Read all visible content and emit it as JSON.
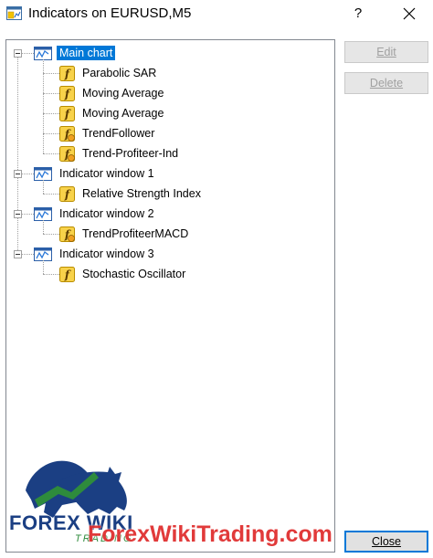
{
  "window": {
    "title": "Indicators on EURUSD,M5",
    "help_label": "?"
  },
  "tree": {
    "groups": [
      {
        "label": "Main chart",
        "selected": true,
        "items": [
          {
            "label": "Parabolic SAR",
            "icon": "builtin-indicator-icon"
          },
          {
            "label": "Moving Average",
            "icon": "builtin-indicator-icon"
          },
          {
            "label": "Moving Average",
            "icon": "builtin-indicator-icon"
          },
          {
            "label": "TrendFollower",
            "icon": "custom-indicator-icon"
          },
          {
            "label": "Trend-Profiteer-Ind",
            "icon": "custom-indicator-icon"
          }
        ]
      },
      {
        "label": "Indicator window 1",
        "selected": false,
        "items": [
          {
            "label": "Relative Strength Index",
            "icon": "builtin-indicator-icon"
          }
        ]
      },
      {
        "label": "Indicator window 2",
        "selected": false,
        "items": [
          {
            "label": "TrendProfiteerMACD",
            "icon": "custom-indicator-icon"
          }
        ]
      },
      {
        "label": "Indicator window 3",
        "selected": false,
        "items": [
          {
            "label": "Stochastic Oscillator",
            "icon": "builtin-indicator-icon"
          }
        ]
      }
    ]
  },
  "buttons": {
    "edit": "Edit",
    "delete": "Delete",
    "close": "Close"
  },
  "watermark": {
    "logo_main": "FOREX WIKI",
    "logo_sub": "TRADING",
    "site": "ForexWikiTrading.com"
  },
  "colors": {
    "selection": "#0078d7",
    "watermark": "#e03030",
    "logo_blue": "#1b3f83",
    "logo_green": "#2e8b3c"
  }
}
